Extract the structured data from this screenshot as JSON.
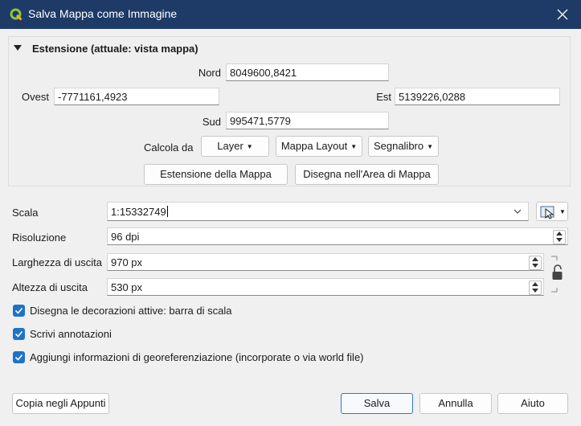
{
  "window": {
    "title": "Salva Mappa come Immagine"
  },
  "extent": {
    "group_title": "Estensione (attuale: vista mappa)",
    "north_label": "Nord",
    "north_value": "8049600,8421",
    "west_label": "Ovest",
    "west_value": "-7771161,4923",
    "east_label": "Est",
    "east_value": "5139226,0288",
    "south_label": "Sud",
    "south_value": "995471,5779",
    "calc_from_label": "Calcola da",
    "layer_btn": "Layer",
    "layout_btn": "Mappa Layout",
    "bookmark_btn": "Segnalibro",
    "map_extent_btn": "Estensione della Mappa",
    "draw_btn": "Disegna nell'Area di Mappa"
  },
  "scale": {
    "label": "Scala",
    "value": "1:15332749"
  },
  "resolution": {
    "label": "Risoluzione",
    "value": "96 dpi"
  },
  "width": {
    "label": "Larghezza di uscita",
    "value": "970 px"
  },
  "height": {
    "label": "Altezza di uscita",
    "value": "530 px"
  },
  "options": [
    {
      "label": "Disegna le decorazioni attive: barra di scala",
      "checked": true
    },
    {
      "label": "Scrivi annotazioni",
      "checked": true
    },
    {
      "label": "Aggiungi informazioni di georeferenziazione (incorporate o via world file)",
      "checked": true
    }
  ],
  "footer": {
    "copy_btn": "Copia negli Appunti",
    "save_btn": "Salva",
    "cancel_btn": "Annulla",
    "help_btn": "Aiuto"
  },
  "colors": {
    "titlebar": "#1e3a66",
    "accent": "#1e73c8"
  }
}
